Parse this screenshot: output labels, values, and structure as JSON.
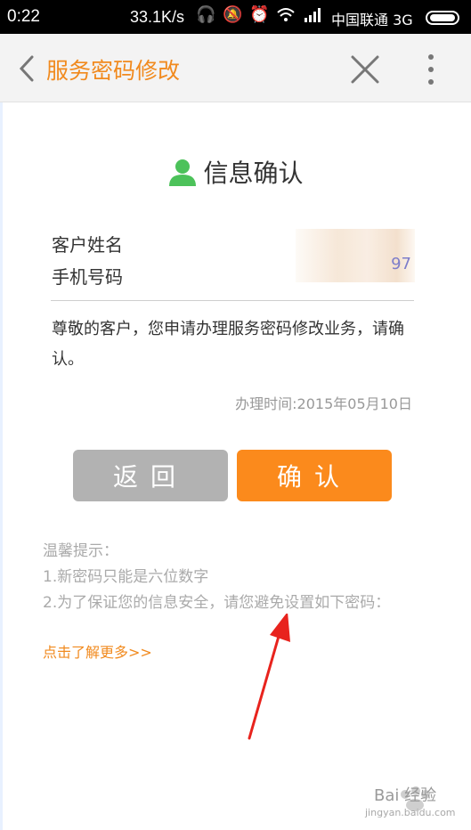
{
  "status_bar": {
    "time": "0:22",
    "speed": "33.1K/s",
    "carrier": "中国联通 3G"
  },
  "header": {
    "title": "服务密码修改"
  },
  "info": {
    "title": "信息确认",
    "customer_name_label": "客户姓名",
    "phone_label": "手机号码",
    "phone_tail": "97",
    "notice": "尊敬的客户，您申请办理服务密码修改业务，请确认。",
    "handle_time": "办理时间:2015年05月10日"
  },
  "buttons": {
    "back": "返回",
    "confirm": "确认"
  },
  "tips": {
    "heading": "温馨提示：",
    "item1": "1.新密码只能是六位数字",
    "item2": "2.为了保证您的信息安全，请您避免设置如下密码：",
    "more": "点击了解更多>>"
  },
  "watermark": {
    "brand": "Bai 经验",
    "url": "jingyan.baidu.com"
  },
  "colors": {
    "accent": "#f18a1e",
    "confirm_button": "#fb8a1c",
    "back_button": "#b2b2b2",
    "person_icon": "#4cc25a",
    "annotation_arrow": "#e8231d"
  }
}
